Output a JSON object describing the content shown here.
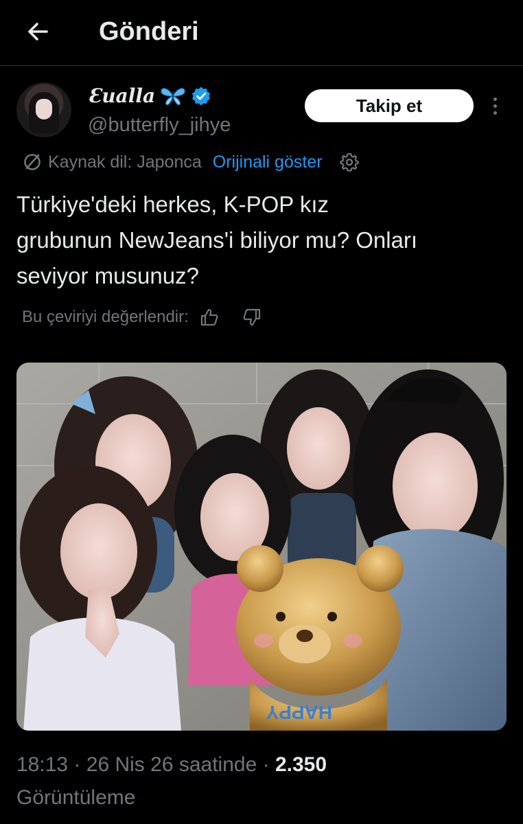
{
  "header": {
    "back_icon": "arrow-left-icon",
    "title": "Gönderi"
  },
  "author": {
    "display_name": "Ɛualla",
    "handle": "@butterfly_jihye",
    "verified_icon": "verified-badge-icon",
    "name_emoji_icon": "butterfly-icon",
    "follow_label": "Takip et"
  },
  "translation": {
    "icon": "translate-icon",
    "source_language": "Kaynak dil: Japonca",
    "show_original": "Orijinali göster",
    "settings_icon": "gear-icon",
    "rate_label": "Bu çeviriyi değerlendir:"
  },
  "post": {
    "text_line_1": "Türkiye'deki herkes, K-POP kız",
    "text_line_2": "grubunun NewJeans'i biliyor mu? Onları",
    "text_line_3": "seviyor musunuz?"
  },
  "media": {
    "balloon_text": "HAPPY"
  },
  "meta": {
    "time": "18:13",
    "separator": "·",
    "date": "26 Nis 26 saatinde",
    "views_count": "2.350",
    "views_label": "Görüntüleme"
  },
  "colors": {
    "background": "#000000",
    "text_primary": "#e7e9ea",
    "text_secondary": "#71767b",
    "accent": "#1d9bf0",
    "divider": "#2f3336"
  }
}
